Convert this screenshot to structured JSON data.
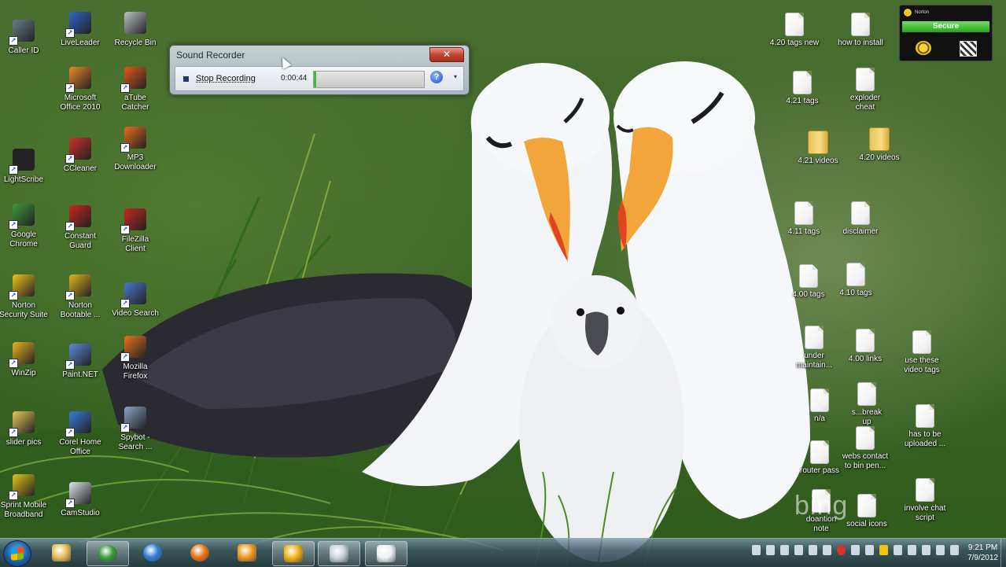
{
  "window": {
    "title": "Sound Recorder",
    "close_label": "✕",
    "stop_label": "Stop Recording",
    "time": "0:00:44",
    "level": 0.02,
    "help_label": "?",
    "menu_arrow": "▾"
  },
  "norton": {
    "brand": "Norton",
    "status": "Secure"
  },
  "watermark": "bing",
  "desktop_left": [
    {
      "label": "Caller ID",
      "icon": "phone-icon"
    },
    {
      "label": "LiveLeader",
      "icon": "liveleader-icon"
    },
    {
      "label": "Recycle Bin",
      "icon": "recycle-bin-icon"
    },
    {
      "label": "Microsoft\nOffice 2010",
      "icon": "office-icon"
    },
    {
      "label": "aTube\nCatcher",
      "icon": "atube-icon"
    },
    {
      "label": "LightScribe",
      "icon": "lightscribe-icon"
    },
    {
      "label": "CCleaner",
      "icon": "ccleaner-icon"
    },
    {
      "label": "MP3\nDownloader",
      "icon": "mp3-icon"
    },
    {
      "label": "Google\nChrome",
      "icon": "chrome-icon"
    },
    {
      "label": "Constant\nGuard",
      "icon": "constant-guard-icon"
    },
    {
      "label": "FileZilla\nClient",
      "icon": "filezilla-icon"
    },
    {
      "label": "Norton\nSecurity Suite",
      "icon": "norton-icon"
    },
    {
      "label": "Norton\nBootable ...",
      "icon": "norton-bootable-icon"
    },
    {
      "label": "Video Search",
      "icon": "video-search-icon"
    },
    {
      "label": "WinZip",
      "icon": "winzip-icon"
    },
    {
      "label": "Paint.NET",
      "icon": "paint-icon"
    },
    {
      "label": "Mozilla\nFirefox",
      "icon": "firefox-icon"
    },
    {
      "label": "slider pics",
      "icon": "folder-icon"
    },
    {
      "label": "Corel Home\nOffice",
      "icon": "corel-icon"
    },
    {
      "label": "Spybot -\nSearch ...",
      "icon": "spybot-icon"
    },
    {
      "label": "Sprint Mobile\nBroadband",
      "icon": "sprint-icon"
    },
    {
      "label": "CamStudio",
      "icon": "camstudio-icon"
    }
  ],
  "desktop_right": [
    {
      "label": "4.20 tags new",
      "icon": "file-icon"
    },
    {
      "label": "how to install",
      "icon": "file-icon"
    },
    {
      "label": "4.21 tags",
      "icon": "file-icon"
    },
    {
      "label": "exploder\ncheat",
      "icon": "file-icon"
    },
    {
      "label": "4.21 videos",
      "icon": "folder-icon"
    },
    {
      "label": "4.20 videos",
      "icon": "folder-icon"
    },
    {
      "label": "4.11 tags",
      "icon": "file-icon"
    },
    {
      "label": "disclaimer",
      "icon": "file-icon"
    },
    {
      "label": "4.00 tags",
      "icon": "file-icon"
    },
    {
      "label": "4.10 tags",
      "icon": "file-icon"
    },
    {
      "label": "under\nmaintain...",
      "icon": "file-icon"
    },
    {
      "label": "4.00 links",
      "icon": "file-icon"
    },
    {
      "label": "use these\nvideo tags",
      "icon": "file-icon"
    },
    {
      "label": "n/a",
      "icon": "file-icon"
    },
    {
      "label": "s...break\nup",
      "icon": "file-icon"
    },
    {
      "label": "has to be\nuploaded ...",
      "icon": "file-icon"
    },
    {
      "label": "router pass",
      "icon": "file-icon"
    },
    {
      "label": "webs contact\nto bin pen...",
      "icon": "file-icon"
    },
    {
      "label": "doantion\nnote",
      "icon": "file-icon"
    },
    {
      "label": "social icons",
      "icon": "file-icon"
    },
    {
      "label": "involve chat\nscript",
      "icon": "file-icon"
    }
  ],
  "clock": {
    "time": "9:21 PM",
    "date": "7/9/2012"
  },
  "taskbar": [
    "explorer",
    "chrome",
    "internet-explorer",
    "firefox",
    "media-player",
    "lightscribe",
    "sound-recorder",
    "camstudio"
  ]
}
